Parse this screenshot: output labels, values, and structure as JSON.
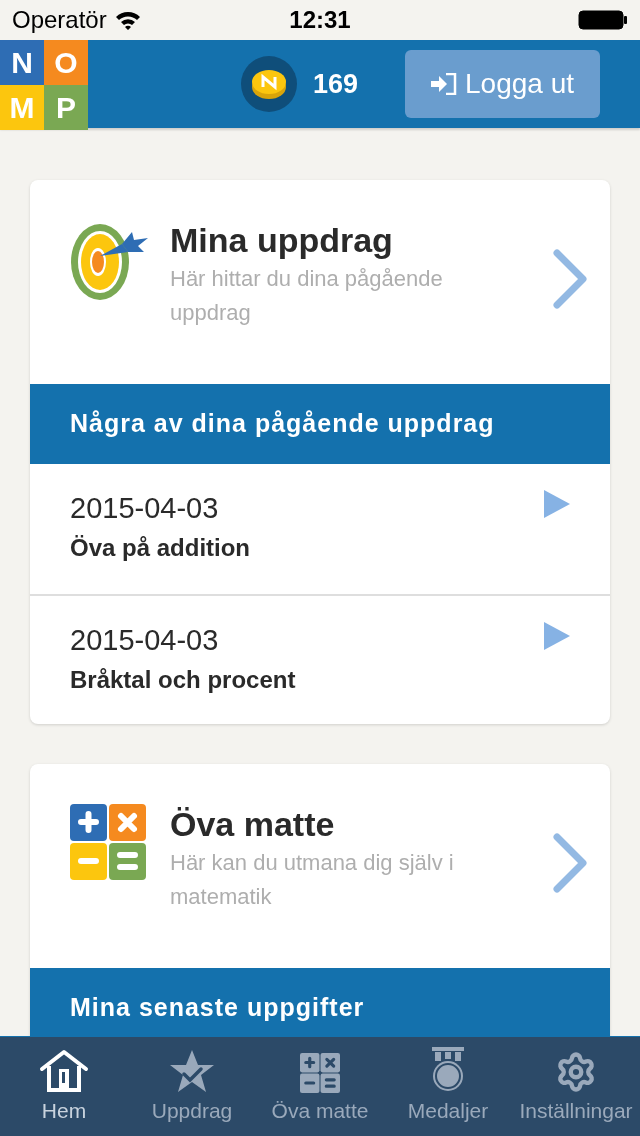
{
  "status_bar": {
    "carrier": "Operatör",
    "time": "12:31"
  },
  "header": {
    "logo_letters": [
      "N",
      "O",
      "M",
      "P"
    ],
    "coins": "169",
    "logout_button": "Logga ut"
  },
  "cards": [
    {
      "kind": "missions",
      "title": "Mina uppdrag",
      "subtitle": "Här hittar du dina pågående uppdrag",
      "section_title": "Några av dina pågående uppdrag",
      "items": [
        {
          "date": "2015-04-03",
          "title": "Öva på addition"
        },
        {
          "date": "2015-04-03",
          "title": "Bråktal och procent"
        }
      ]
    },
    {
      "kind": "practice",
      "title": "Öva matte",
      "subtitle": "Här kan du utmana dig själv i matematik",
      "section_title": "Mina senaste uppgifter"
    }
  ],
  "tab_bar": [
    {
      "kind": "home",
      "label": "Hem",
      "selected": true
    },
    {
      "kind": "missions",
      "label": "Uppdrag",
      "selected": false
    },
    {
      "kind": "practice",
      "label": "Öva matte",
      "selected": false
    },
    {
      "kind": "medals",
      "label": "Medaljer",
      "selected": false
    },
    {
      "kind": "settings",
      "label": "Inställningar",
      "selected": false
    }
  ]
}
